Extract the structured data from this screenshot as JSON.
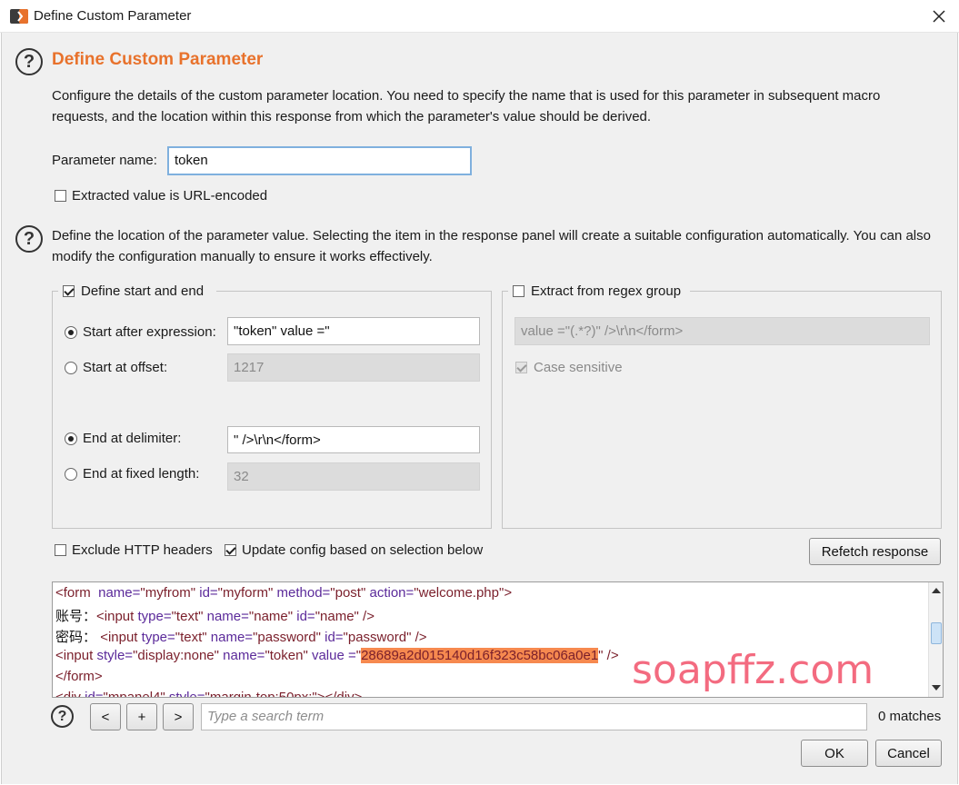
{
  "window": {
    "title": "Define Custom Parameter"
  },
  "section1": {
    "heading": "Define Custom Parameter",
    "description": "Configure the details of the custom parameter location. You need to specify the name that is used for this parameter in subsequent macro requests, and the location within this response from which the parameter's value should be derived.",
    "parameter_name_label": "Parameter name:",
    "parameter_name_value": "token",
    "url_encoded_label": "Extracted value is URL-encoded",
    "url_encoded_checked": false
  },
  "section2": {
    "description": "Define the location of the parameter value. Selecting the item in the response panel will create a suitable configuration automatically. You can also modify the configuration manually to ensure it works effectively."
  },
  "start_end_group": {
    "legend": "Define start and end",
    "checked": true,
    "start_after_label": "Start after expression:",
    "start_after_value": "\"token\" value =\"",
    "start_offset_label": "Start at offset:",
    "start_offset_value": "1217",
    "end_delimiter_label": "End at delimiter:",
    "end_delimiter_value": "\" />\\r\\n</form>",
    "end_fixed_label": "End at fixed length:",
    "end_fixed_value": "32"
  },
  "regex_group": {
    "legend": "Extract from regex group",
    "checked": false,
    "regex_value": "value =\"(.*?)\" />\\r\\n</form>",
    "case_sensitive_label": "Case sensitive",
    "case_sensitive_checked": true
  },
  "options": {
    "exclude_headers_label": "Exclude HTTP headers",
    "exclude_headers_checked": false,
    "update_config_label": "Update config based on selection below",
    "update_config_checked": true,
    "refetch_button": "Refetch response"
  },
  "response": {
    "line1": {
      "t1": "<form",
      "a1": "name=",
      "v1": "\"myfrom\"",
      "a2": "id=",
      "v2": "\"myform\"",
      "a3": "method=",
      "v3": "\"post\"",
      "a4": "action=",
      "v4": "\"welcome.php\"",
      "t2": ">"
    },
    "line2": {
      "prefix": "账号：",
      "t1": "<input",
      "a1": "type=",
      "v1": "\"text\"",
      "a2": "name=",
      "v2": "\"name\"",
      "a3": "id=",
      "v3": "\"name\"",
      "t2": "/>"
    },
    "line3": {
      "prefix": "密码：",
      "t1": "<input",
      "a1": "type=",
      "v1": "\"text\"",
      "a2": "name=",
      "v2": "\"password\"",
      "a3": "id=",
      "v3": "\"password\"",
      "t2": "/>"
    },
    "line4": {
      "t1": "<input",
      "a1": "style=",
      "v1": "\"display:none\"",
      "a2": "name=",
      "v2": "\"token\"",
      "a3": "value =",
      "q1": "\"",
      "selected": "28689a2d015140d16f323c58bc06a0e1",
      "q2": "\"",
      "t2": "/>"
    },
    "line5": {
      "t1": "</form>"
    },
    "line6": {
      "t1": "<div",
      "a1": "id=",
      "v1": "\"mpanel4\"",
      "a2": "style=",
      "v2": "\"margin-top:50px;\"",
      "t2": "></div>"
    }
  },
  "search": {
    "prev": "<",
    "add": "+",
    "next": ">",
    "placeholder": "Type a search term",
    "matches": "0 matches"
  },
  "footer": {
    "ok": "OK",
    "cancel": "Cancel"
  },
  "watermark": "soapffz.com",
  "colors": {
    "heading": "#e8722c",
    "selection": "#f6894f",
    "tag": "#7a1f2b",
    "attribute": "#5b2a9a",
    "watermark": "#f2526a"
  }
}
